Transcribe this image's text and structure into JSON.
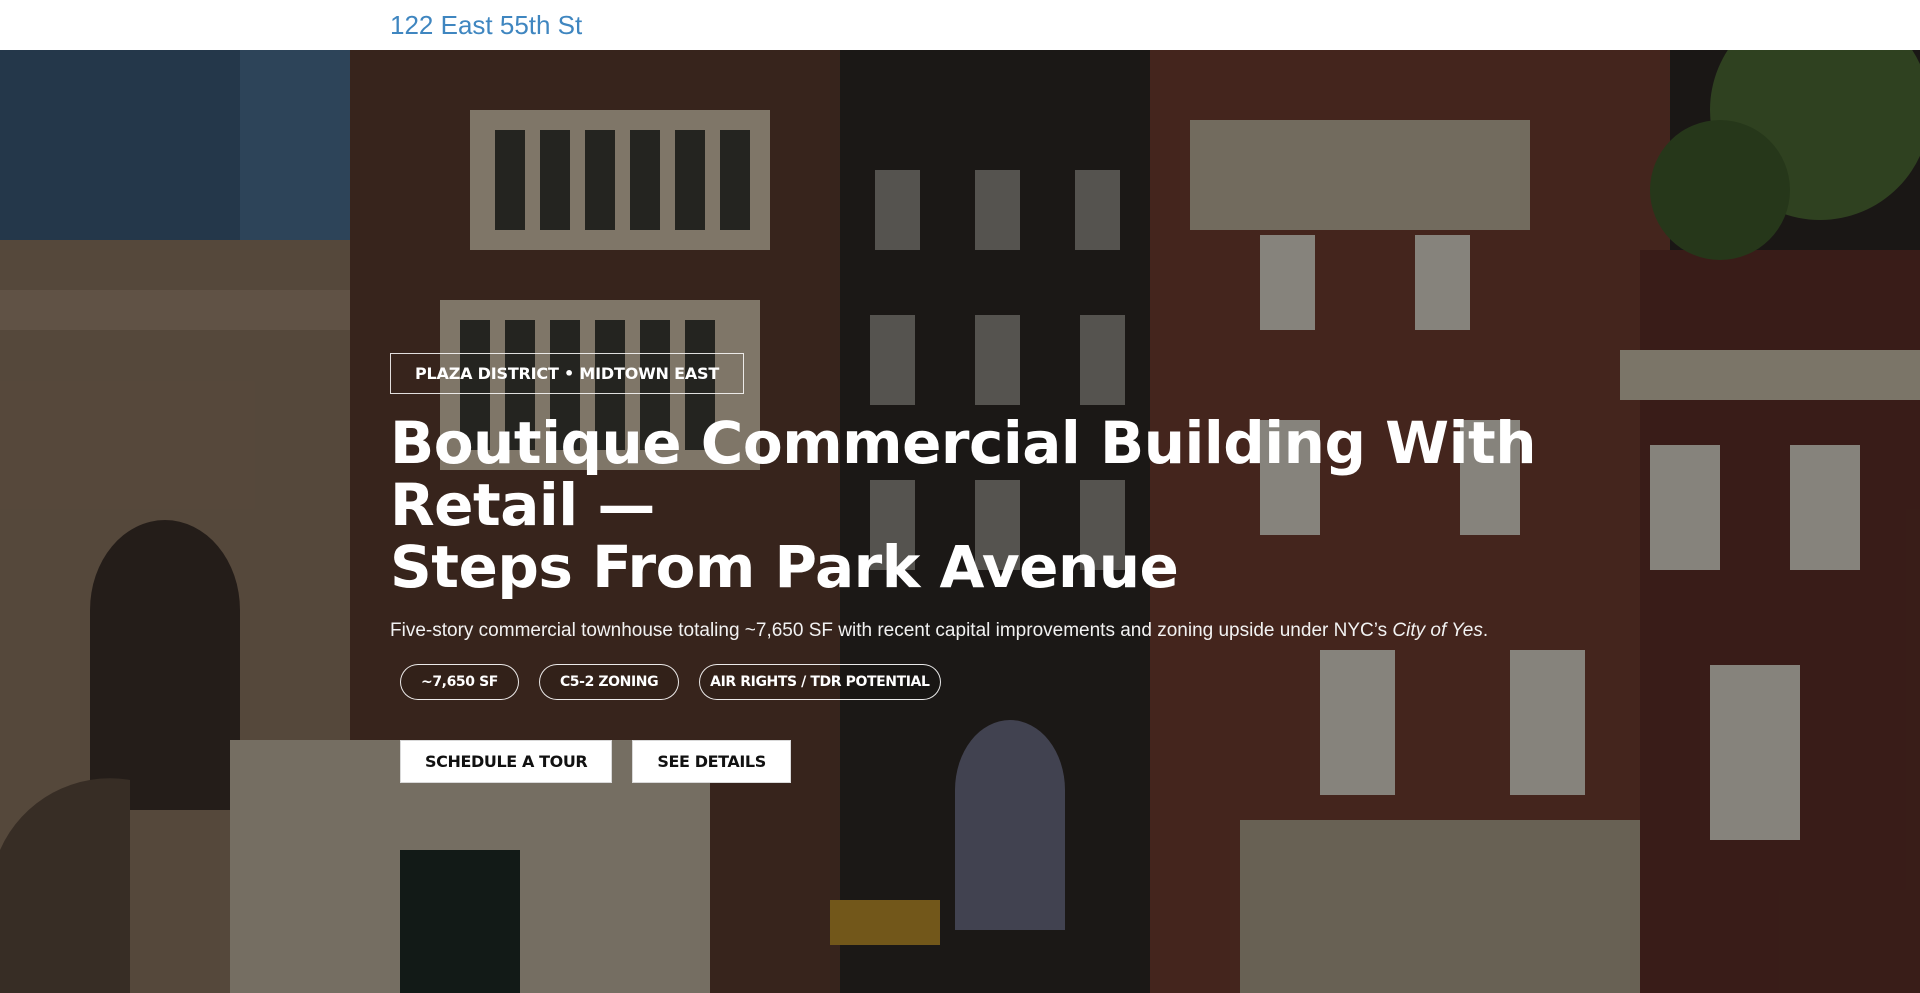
{
  "site": {
    "title": "122 East 55th St"
  },
  "hero": {
    "eyebrow": "PLAZA DISTRICT • MIDTOWN EAST",
    "headline_line1": "Boutique Commercial Building With Retail —",
    "headline_line2": "Steps From Park Avenue",
    "subline_text": "Five-story commercial townhouse totaling ~7,650 SF with recent capital improvements and zoning upside under NYC’s ",
    "subline_emphasis": "City of Yes",
    "subline_end": ".",
    "chips": [
      "~7,650 SF",
      "C5-2 ZONING",
      "AIR RIGHTS / TDR POTENTIAL"
    ],
    "buttons": {
      "primary": "SCHEDULE A TOUR",
      "secondary": "SEE DETAILS"
    }
  },
  "colors": {
    "title": "#3f86c0",
    "overlay": "rgba(0,0,0,0.38)"
  }
}
